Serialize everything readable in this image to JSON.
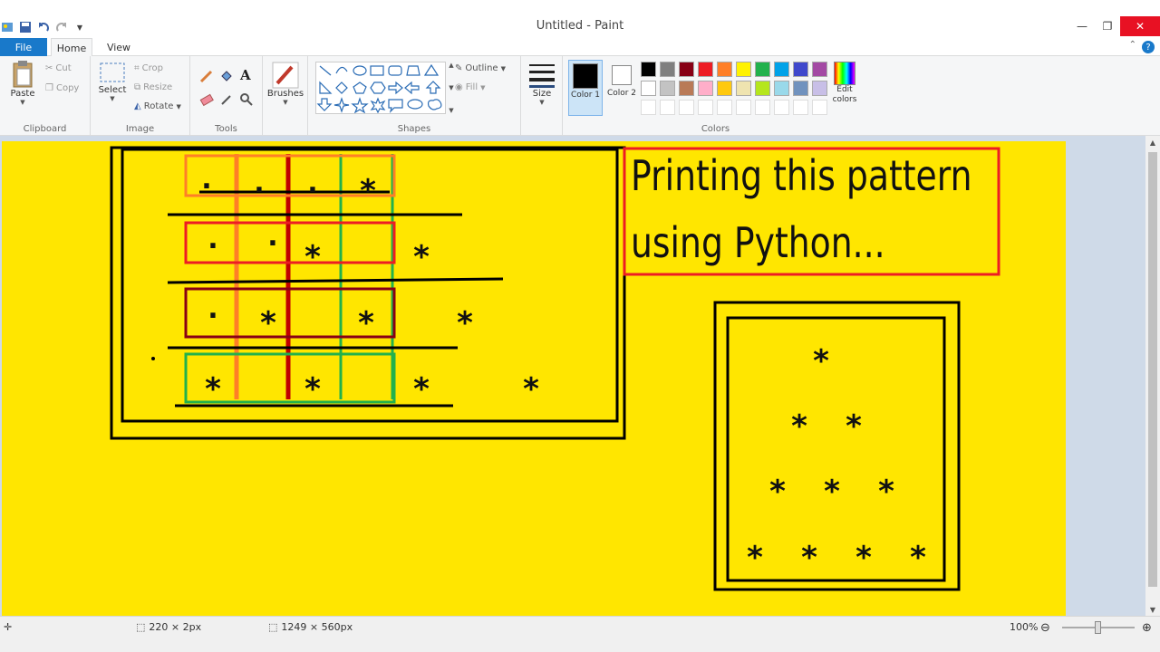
{
  "window": {
    "title": "Untitled - Paint"
  },
  "tabs": [
    {
      "label": "File"
    },
    {
      "label": "Home"
    },
    {
      "label": "View"
    }
  ],
  "clipboard": {
    "paste": "Paste",
    "cut": "Cut",
    "copy": "Copy",
    "label": "Clipboard"
  },
  "image": {
    "select": "Select",
    "crop": "Crop",
    "resize": "Resize",
    "rotate": "Rotate",
    "label": "Image"
  },
  "tools": {
    "label": "Tools"
  },
  "brushes": {
    "label": "Brushes"
  },
  "shapes": {
    "outline": "Outline",
    "fill": "Fill",
    "label": "Shapes"
  },
  "size": {
    "label": "Size"
  },
  "colors": {
    "color1": "Color 1",
    "color2": "Color 2",
    "edit": "Edit colors",
    "label": "Colors",
    "palette": [
      "#000000",
      "#7f7f7f",
      "#880015",
      "#ed1c24",
      "#ff7f27",
      "#fff200",
      "#22b14c",
      "#00a2e8",
      "#3f48cc",
      "#a349a4",
      "#ffffff",
      "#c3c3c3",
      "#b97a57",
      "#ffaec9",
      "#ffc90e",
      "#efe4b0",
      "#b5e61d",
      "#99d9ea",
      "#7092be",
      "#c8bfe7"
    ]
  },
  "canvas": {
    "title_line1": "Printing this pattern",
    "title_line2": "using Python...",
    "grid_marks": [
      ".",
      ".",
      ".",
      "*",
      ".",
      ".",
      "*",
      "*",
      ".",
      "*",
      "*",
      "*",
      "*",
      "*",
      "*",
      "*"
    ],
    "pyramid": [
      "*",
      "*",
      "*",
      "*",
      "*",
      "*",
      "*",
      "*",
      "*",
      "*"
    ]
  },
  "status": {
    "selection": "220 × 2px",
    "canvas_size": "1249 × 560px",
    "zoom": "100%"
  }
}
